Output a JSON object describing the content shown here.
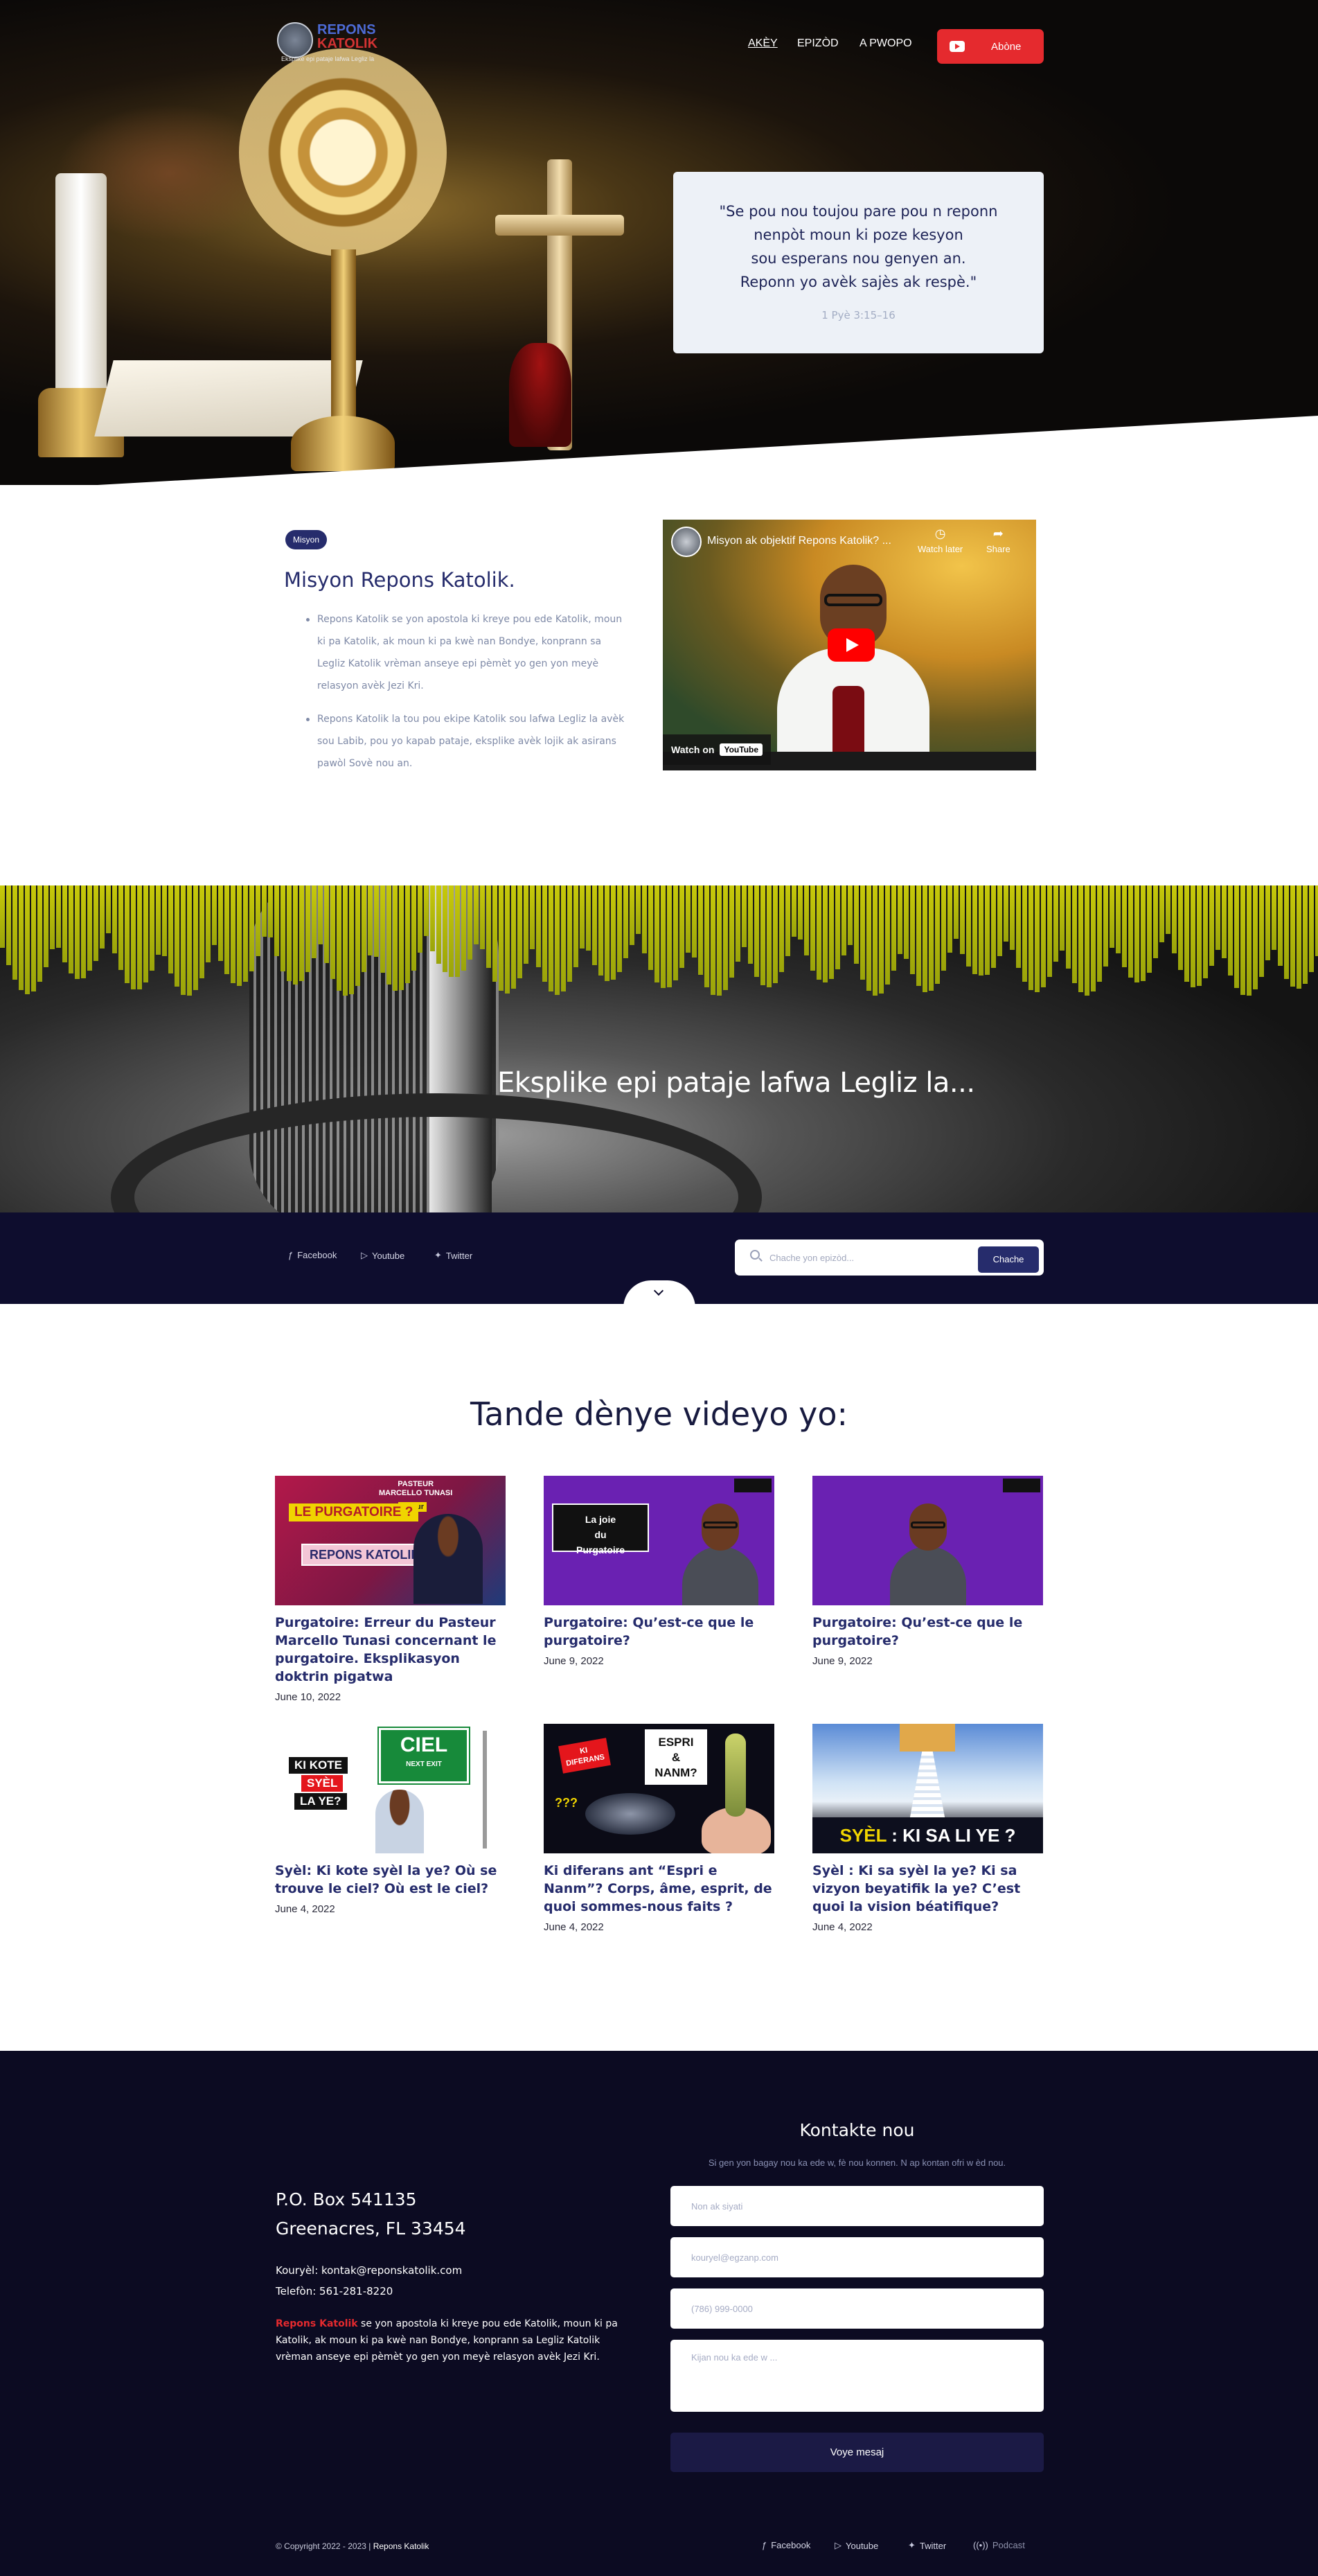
{
  "header": {
    "logo_line1": "REPONS",
    "logo_line2": "KATOLIK",
    "logo_tagline": "Eksplike epi pataje lafwa Legliz la",
    "nav": [
      {
        "label": "AKÈY",
        "active": true
      },
      {
        "label": "EPIZÒD",
        "active": false
      },
      {
        "label": "A PWOPO",
        "active": false
      }
    ],
    "subscribe_label": "Abòne",
    "subscribe_icon": "youtube-icon"
  },
  "hero": {
    "quote": "\"Se pou nou toujou pare pou n reponn\nnenpòt moun ki poze kesyon\nsou esperans nou genyen an.\nReponn yo avèk sajès ak respè.\"",
    "reference": "1 Pyè 3:15–16"
  },
  "mission": {
    "badge": "Misyon",
    "title": "Misyon Repons Katolik.",
    "points": [
      "Repons Katolik se yon apostola ki kreye pou ede Katolik, moun ki pa Katolik, ak moun ki pa kwè nan Bondye, konprann sa Legliz Katolik vrèman anseye epi pèmèt yo gen yon meyè relasyon avèk Jezi Kri.",
      "Repons Katolik la tou pou ekipe Katolik sou lafwa Legliz la avèk sou Labib, pou yo kapab pataje, eksplike avèk lojik ak asirans pawòl Sovè nou an."
    ],
    "video": {
      "title": "Misyon ak objektif Repons Katolik? ...",
      "watch_later": "Watch later",
      "share": "Share",
      "watch_on": "Watch on",
      "platform": "YouTube"
    }
  },
  "banner": {
    "headline": "Eksplike epi pataje lafwa Legliz la..."
  },
  "social_bar": {
    "links": [
      {
        "label": "Facebook",
        "icon": "facebook-icon"
      },
      {
        "label": "Youtube",
        "icon": "youtube-icon"
      },
      {
        "label": "Twitter",
        "icon": "twitter-icon"
      }
    ],
    "search_placeholder": "Chache yon epizòd...",
    "search_button": "Chache"
  },
  "latest": {
    "title": "Tande dènye videyo yo:",
    "videos": [
      {
        "title": "Purgatoire: Erreur du Pasteur Marcello Tunasi concernant le purgatoire. Eksplikasyon doktrin pigatwa",
        "date": "June 10, 2022"
      },
      {
        "title": "Purgatoire: Qu’est-ce que le purgatoire?",
        "date": "June 9, 2022"
      },
      {
        "title": "Purgatoire: Qu’est-ce que le purgatoire?",
        "date": "June 9, 2022"
      },
      {
        "title": "Syèl: Ki kote syèl la ye? Où se trouve le ciel? Où est le ciel?",
        "date": "June 4, 2022"
      },
      {
        "title": "Ki diferans ant “Espri e Nanm”? Corps, âme, esprit, de quoi sommes-nous faits ?",
        "date": "June 4, 2022"
      },
      {
        "title": "Syèl : Ki sa syèl la ye? Ki sa vizyon beyatifik la ye? C’est quoi la vision béatifique?",
        "date": "June 4, 2022"
      }
    ],
    "thumbs": {
      "t1_a": "LE PURGATOIRE ?",
      "t1_b": "REPONS KATOLIK",
      "t1_c": "PASTEUR\nMARCELLO TUNASI",
      "t1_d": "Erreur",
      "t2_box": "La joie\ndu\nPurgatoire",
      "t4_k1": "KI KOTE",
      "t4_k2": "SYÈL",
      "t4_k3": "LA YE?",
      "t4_sign": "CIEL",
      "t4_exit": "NEXT EXIT",
      "t5_r": "KI\nDIFERANS",
      "t5_w": "ESPRI\n&\nNANM?",
      "t5_q": "???",
      "t6_a": "SYÈL",
      "t6_b": " : KI SA LI YE ?"
    }
  },
  "footer": {
    "address": "P.O. Box 541135\nGreenacres, FL 33454",
    "email_line": "Kouryèl: kontak@reponskatolik.com",
    "phone_line": "Telefòn: 561-281-8220",
    "about_brand": "Repons Katolik",
    "about_text": " se yon apostola ki kreye pou ede Katolik, moun ki pa Katolik, ak moun ki pa kwè nan Bondye, konprann sa Legliz Katolik vrèman anseye epi pèmèt yo gen yon meyè relasyon avèk Jezi Kri.",
    "contact_title": "Kontakte nou",
    "contact_sub": "Si gen yon bagay nou ka ede w, fè nou konnen. N ap kontan ofri w èd nou.",
    "name_placeholder": "Non ak siyati",
    "email_placeholder": "kouryel@egzanp.com",
    "phone_placeholder": "(786) 999-0000",
    "message_placeholder": "Kijan nou ka ede w ...",
    "send_label": "Voye mesaj",
    "copyright": "© Copyright 2022 - 2023 | ",
    "copyright_brand": "Repons Katolik",
    "links": [
      {
        "label": "Facebook",
        "icon": "facebook-icon"
      },
      {
        "label": "Youtube",
        "icon": "youtube-icon"
      },
      {
        "label": "Twitter",
        "icon": "twitter-icon"
      },
      {
        "label": "Podcast",
        "icon": "podcast-icon"
      }
    ]
  },
  "colors": {
    "brand_navy": "#262c6c",
    "dark_bg": "#0c0b22",
    "accent_red": "#e52a2e"
  }
}
